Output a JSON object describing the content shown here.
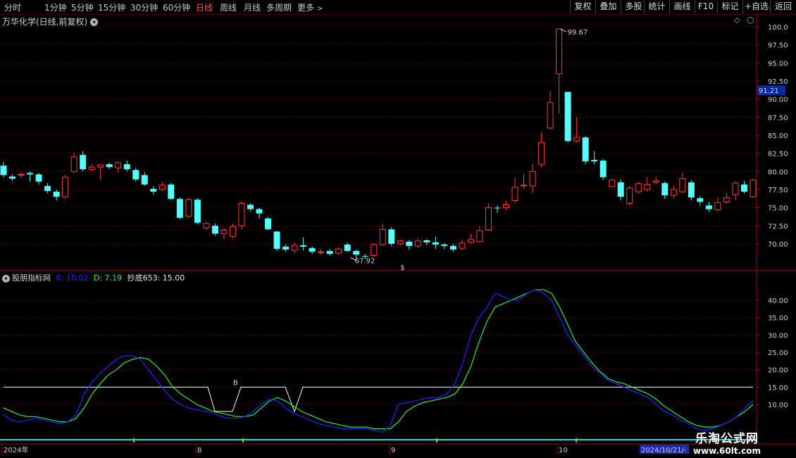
{
  "toolbar": {
    "periods": [
      "分时",
      "1分钟",
      "5分钟",
      "15分钟",
      "30分钟",
      "60分钟",
      "日线",
      "周线",
      "月线",
      "多周期",
      "更多"
    ],
    "active_period": "日线",
    "tools": [
      "复权",
      "叠加",
      "多股",
      "统计",
      "画线",
      "F10",
      "标记",
      "+自选",
      "返回"
    ]
  },
  "main_chart": {
    "title": "万华化学(日线,前复权)",
    "price_labels": [
      "100.0",
      "97.50",
      "95.00",
      "92.50",
      "90.00",
      "87.50",
      "85.00",
      "82.50",
      "80.00",
      "77.50",
      "75.00",
      "72.50",
      "70.00"
    ],
    "current_price": "91.21",
    "high_label": "99.67",
    "low_label": "67.92",
    "signal_mark": "$",
    "colors": {
      "up": "#ff3b3b",
      "down": "#54ffff",
      "grid": "#6e0000",
      "price_box": "#0a2aa0"
    }
  },
  "indicator": {
    "name": "股朋指标网",
    "k_label": "K: 10.02",
    "d_label": "D: 7.19",
    "chaodi_label": "抄底653: 15.00",
    "b_mark": "B",
    "labels": [
      "40.00",
      "35.00",
      "30.00",
      "25.00",
      "20.00",
      "15.00",
      "10.00"
    ],
    "colors": {
      "k": "#2323ff",
      "d": "#33ee33",
      "line": "#ffffff"
    }
  },
  "time_axis": {
    "labels": [
      "2024年",
      "8",
      "9",
      "10"
    ],
    "cursor_date": "2024/10/21/-"
  },
  "watermark": {
    "title": "乐淘公式网",
    "url": "www.60lt.com"
  },
  "chart_data": {
    "type": "candlestick",
    "price_range": [
      67,
      102
    ],
    "candles": [
      [
        80.8,
        79.5,
        81.3,
        79.2
      ],
      [
        79.3,
        79.0,
        79.6,
        78.7
      ],
      [
        79.5,
        79.6,
        79.9,
        79.1
      ],
      [
        79.8,
        79.6,
        80.0,
        78.6
      ],
      [
        79.6,
        78.6,
        79.8,
        78.2
      ],
      [
        78.0,
        77.3,
        78.4,
        77.0
      ],
      [
        77.2,
        76.5,
        77.5,
        76.0
      ],
      [
        76.5,
        79.2,
        79.5,
        76.3
      ],
      [
        80.0,
        82.0,
        82.6,
        79.8
      ],
      [
        82.3,
        80.3,
        82.8,
        80.0
      ],
      [
        80.3,
        80.6,
        81.0,
        80.0
      ],
      [
        80.6,
        80.9,
        81.0,
        78.8
      ],
      [
        81.0,
        80.6,
        81.2,
        80.3
      ],
      [
        80.5,
        81.2,
        81.4,
        79.8
      ],
      [
        81.0,
        80.3,
        81.5,
        80.0
      ],
      [
        80.2,
        78.9,
        80.5,
        78.6
      ],
      [
        79.5,
        78.2,
        79.9,
        78.0
      ],
      [
        77.6,
        77.2,
        78.0,
        76.8
      ],
      [
        77.5,
        78.1,
        78.5,
        77.3
      ],
      [
        78.2,
        76.2,
        78.4,
        76.0
      ],
      [
        76.2,
        73.6,
        76.4,
        73.4
      ],
      [
        73.8,
        76.1,
        76.4,
        73.5
      ],
      [
        76.1,
        72.9,
        76.3,
        72.7
      ],
      [
        72.2,
        72.8,
        73.0,
        71.9
      ],
      [
        72.5,
        71.4,
        72.8,
        71.1
      ],
      [
        71.4,
        71.9,
        72.2,
        70.6
      ],
      [
        71.0,
        72.4,
        72.8,
        70.8
      ],
      [
        72.5,
        75.6,
        75.9,
        72.0
      ],
      [
        75.4,
        74.8,
        75.6,
        74.5
      ],
      [
        74.8,
        74.2,
        75.0,
        73.5
      ],
      [
        73.5,
        72.0,
        73.7,
        71.9
      ],
      [
        71.7,
        69.3,
        71.8,
        69.0
      ],
      [
        69.6,
        69.2,
        69.9,
        68.9
      ],
      [
        69.1,
        69.8,
        70.2,
        68.7
      ],
      [
        69.8,
        69.6,
        70.9,
        69.1
      ],
      [
        69.4,
        68.9,
        69.6,
        68.6
      ],
      [
        68.8,
        68.9,
        69.3,
        68.5
      ],
      [
        69.0,
        68.6,
        69.3,
        68.4
      ],
      [
        68.7,
        69.3,
        69.5,
        68.5
      ],
      [
        69.9,
        69.0,
        70.2,
        68.9
      ],
      [
        69.0,
        68.5,
        69.2,
        67.9
      ],
      [
        68.3,
        68.2,
        68.6,
        67.9
      ],
      [
        68.4,
        69.9,
        70.1,
        68.2
      ],
      [
        69.9,
        72.0,
        72.8,
        69.7
      ],
      [
        72.0,
        70.0,
        72.3,
        69.7
      ],
      [
        70.0,
        70.4,
        70.6,
        69.8
      ],
      [
        70.3,
        69.7,
        70.5,
        69.2
      ],
      [
        69.7,
        70.4,
        70.7,
        69.4
      ],
      [
        70.5,
        70.2,
        70.6,
        69.8
      ],
      [
        70.2,
        69.9,
        71.0,
        69.3
      ],
      [
        69.9,
        69.7,
        70.1,
        69.3
      ],
      [
        69.7,
        69.2,
        70.0,
        68.9
      ],
      [
        69.4,
        70.1,
        70.6,
        69.2
      ],
      [
        70.2,
        70.6,
        71.4,
        70.0
      ],
      [
        70.3,
        71.8,
        72.4,
        70.2
      ],
      [
        71.9,
        75.0,
        75.6,
        71.8
      ],
      [
        75.0,
        74.9,
        75.3,
        74.3
      ],
      [
        75.0,
        75.4,
        75.9,
        74.7
      ],
      [
        76.0,
        77.8,
        79.2,
        75.6
      ],
      [
        78.0,
        78.1,
        79.6,
        77.6
      ],
      [
        78.0,
        80.0,
        81.0,
        77.0
      ],
      [
        81.0,
        84.0,
        85.4,
        80.6
      ],
      [
        86.0,
        89.5,
        91.1,
        85.8
      ],
      [
        93.5,
        99.7,
        99.7,
        88.0
      ],
      [
        91.0,
        84.2,
        91.0,
        84.0
      ],
      [
        84.2,
        84.7,
        87.5,
        84.0
      ],
      [
        84.7,
        81.4,
        84.9,
        81.0
      ],
      [
        81.6,
        81.4,
        82.8,
        81.0
      ],
      [
        81.5,
        79.2,
        81.7,
        78.8
      ],
      [
        77.9,
        78.8,
        79.0,
        77.8
      ],
      [
        78.5,
        76.5,
        78.9,
        76.0
      ],
      [
        75.6,
        77.7,
        78.0,
        75.3
      ],
      [
        77.2,
        78.3,
        78.6,
        77.0
      ],
      [
        77.5,
        78.2,
        79.2,
        77.2
      ],
      [
        78.5,
        78.7,
        79.3,
        78.2
      ],
      [
        78.4,
        76.7,
        78.6,
        76.2
      ],
      [
        76.7,
        77.5,
        78.0,
        76.3
      ],
      [
        77.2,
        79.0,
        79.8,
        77.0
      ],
      [
        78.5,
        76.4,
        78.8,
        76.0
      ],
      [
        76.3,
        75.8,
        76.6,
        75.3
      ],
      [
        75.3,
        74.8,
        75.8,
        74.4
      ],
      [
        74.7,
        75.7,
        76.4,
        74.5
      ],
      [
        75.8,
        76.4,
        77.0,
        75.5
      ],
      [
        76.8,
        78.4,
        78.6,
        76.0
      ],
      [
        78.2,
        77.2,
        78.7,
        77.0
      ],
      [
        76.5,
        78.8,
        79.0,
        76.3
      ]
    ],
    "k_series": [
      7,
      5.5,
      5,
      5.5,
      6,
      5.5,
      5,
      4.5,
      5,
      7,
      13,
      16.5,
      19,
      21,
      23,
      24,
      24,
      23,
      20,
      17,
      14,
      11.5,
      10,
      9,
      8.5,
      8,
      7.5,
      6.5,
      6,
      6,
      6.5,
      8,
      10,
      11.5,
      11,
      9,
      7.5,
      6.5,
      5.5,
      4.5,
      4,
      3.5,
      3,
      3,
      3,
      3,
      2.5,
      2,
      4,
      10,
      10.5,
      11,
      11.5,
      12,
      12,
      13,
      16,
      22,
      30,
      35,
      38,
      42,
      41,
      40,
      40,
      42,
      43,
      42,
      40,
      35,
      30,
      27,
      24,
      21,
      19,
      17,
      16,
      15,
      14,
      13,
      12,
      10,
      8,
      7,
      5.5,
      4.5,
      3,
      2.5,
      3,
      4,
      5,
      6.5,
      9,
      11
    ],
    "d_series": [
      9,
      8,
      7,
      6.5,
      6.5,
      6,
      5.5,
      5,
      5,
      6,
      9,
      13,
      16,
      18.5,
      20,
      22,
      23,
      23.5,
      23,
      21,
      18.5,
      15,
      13,
      11.5,
      10,
      9,
      8,
      7.5,
      7,
      6.5,
      6.5,
      7,
      9,
      11,
      12,
      11,
      9.5,
      8,
      7,
      6,
      5,
      4.5,
      4,
      3.5,
      3.5,
      3.5,
      3,
      3,
      3,
      5,
      8,
      9.5,
      10.5,
      11,
      11.5,
      12,
      13,
      16,
      21,
      28,
      34,
      38,
      39,
      40,
      41,
      42,
      43,
      43,
      42,
      38,
      33,
      28,
      25,
      22,
      19.5,
      17.5,
      16.5,
      16,
      15,
      14,
      13,
      11.5,
      9.5,
      8,
      6.5,
      5,
      4,
      3.5,
      3.5,
      4,
      5,
      6.5,
      8,
      10
    ]
  }
}
